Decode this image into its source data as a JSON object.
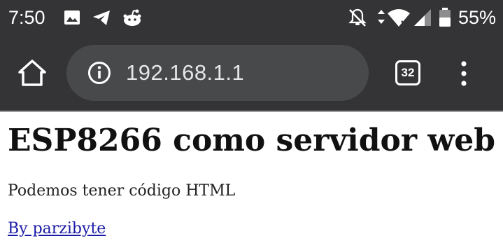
{
  "status_bar": {
    "time": "7:50",
    "battery_percent": "55%",
    "icons": [
      "gallery-icon",
      "telegram-icon",
      "reddit-icon",
      "notifications-off-icon",
      "data-transfer-icon",
      "wifi-icon",
      "cell-signal-icon",
      "battery-icon"
    ]
  },
  "browser": {
    "url": "192.168.1.1",
    "tab_count": "32"
  },
  "page": {
    "heading": "ESP8266 como servidor web",
    "paragraph": "Podemos tener código HTML",
    "link_text": "By parzibyte"
  },
  "colors": {
    "toolbar": "#343436",
    "omnibox": "#47494b",
    "link": "#1a1aa6"
  }
}
